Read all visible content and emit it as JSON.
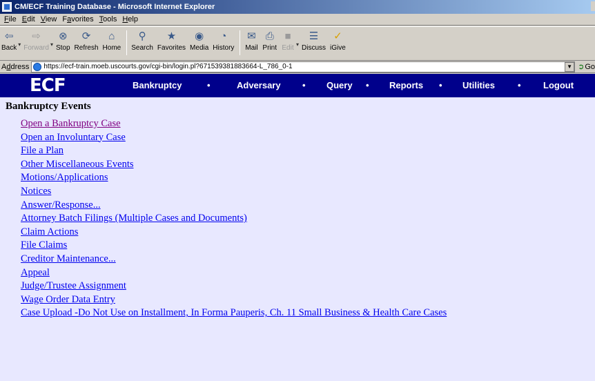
{
  "window": {
    "title": "CM/ECF Training Database - Microsoft Internet Explorer"
  },
  "menubar": {
    "items": [
      {
        "pre": "",
        "u": "F",
        "post": "ile"
      },
      {
        "pre": "",
        "u": "E",
        "post": "dit"
      },
      {
        "pre": "",
        "u": "V",
        "post": "iew"
      },
      {
        "pre": "F",
        "u": "a",
        "post": "vorites"
      },
      {
        "pre": "",
        "u": "T",
        "post": "ools"
      },
      {
        "pre": "",
        "u": "H",
        "post": "elp"
      }
    ]
  },
  "toolbar": {
    "back": "Back",
    "forward": "Forward",
    "stop": "Stop",
    "refresh": "Refresh",
    "home": "Home",
    "search": "Search",
    "favorites": "Favorites",
    "media": "Media",
    "history": "History",
    "mail": "Mail",
    "print": "Print",
    "edit": "Edit",
    "discuss": "Discuss",
    "igive": "iGive"
  },
  "address": {
    "label_pre": "A",
    "label_u": "d",
    "label_post": "dress",
    "url": "https://ecf-train.moeb.uscourts.gov/cgi-bin/login.pl?671539381883664-L_786_0-1",
    "go": "Go"
  },
  "ecf": {
    "logo": "ECF",
    "nav": [
      "Bankruptcy",
      "Adversary",
      "Query",
      "Reports",
      "Utilities",
      "Logout"
    ],
    "separator": "•"
  },
  "page": {
    "heading": "Bankruptcy Events",
    "events": [
      "Open a Bankruptcy Case",
      "Open an Involuntary Case",
      "File a Plan",
      "Other Miscellaneous Events",
      "Motions/Applications",
      "Notices",
      "Answer/Response...",
      "Attorney Batch Filings (Multiple Cases and Documents)",
      "Claim Actions",
      "File Claims",
      "Creditor Maintenance...",
      "Appeal",
      "Judge/Trustee Assignment",
      "Wage Order Data Entry",
      "Case Upload -Do Not Use on Installment, In Forma Pauperis, Ch. 11 Small Business & Health Care Cases"
    ]
  },
  "colors": {
    "nav_bg": "#00008b",
    "content_bg": "#e8e8ff",
    "link": "#0000ee",
    "visited_link": "#800080"
  }
}
